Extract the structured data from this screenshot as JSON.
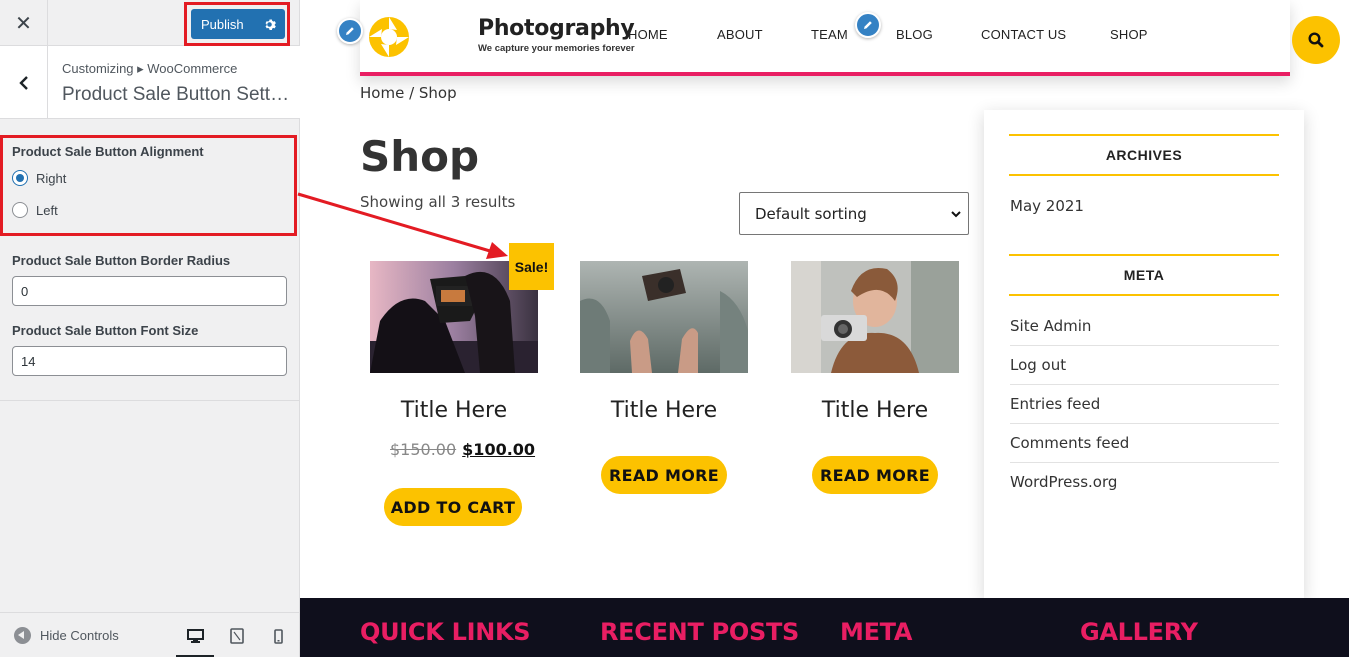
{
  "customizer": {
    "close_icon": "close-icon",
    "publish_label": "Publish",
    "breadcrumb": "Customizing ▸ WooCommerce",
    "title": "Product Sale Button Setti…",
    "alignment": {
      "label": "Product Sale Button Alignment",
      "options": [
        "Right",
        "Left"
      ],
      "selected": "Right"
    },
    "border_radius": {
      "label": "Product Sale Button Border Radius",
      "value": "0"
    },
    "font_size": {
      "label": "Product Sale Button Font Size",
      "value": "14"
    },
    "hide_controls": "Hide Controls",
    "active_device": "desktop"
  },
  "site": {
    "logo_name": "Photography",
    "tagline": "We capture your memories forever",
    "nav": [
      "HOME",
      "ABOUT",
      "TEAM",
      "BLOG",
      "CONTACT US",
      "SHOP"
    ],
    "accent": "#fcc200",
    "brand": "#e91e63"
  },
  "shop": {
    "breadcrumb": {
      "home": "Home",
      "sep": " / ",
      "current": "Shop"
    },
    "title": "Shop",
    "results": "Showing all 3 results",
    "sort_value": "Default sorting",
    "products": [
      {
        "title": "Title Here",
        "old_price": "$150.00",
        "price": "$100.00",
        "button": "ADD TO CART",
        "badge": "Sale!"
      },
      {
        "title": "Title Here",
        "button": "READ MORE"
      },
      {
        "title": "Title Here",
        "button": "READ MORE"
      }
    ]
  },
  "sidebar": {
    "archives_title": "ARCHIVES",
    "archives": [
      "May 2021"
    ],
    "meta_title": "META",
    "meta": [
      "Site Admin",
      "Log out",
      "Entries feed",
      "Comments feed",
      "WordPress.org"
    ]
  },
  "footer": {
    "headings": [
      "QUICK LINKS",
      "RECENT POSTS",
      "META",
      "GALLERY"
    ]
  }
}
